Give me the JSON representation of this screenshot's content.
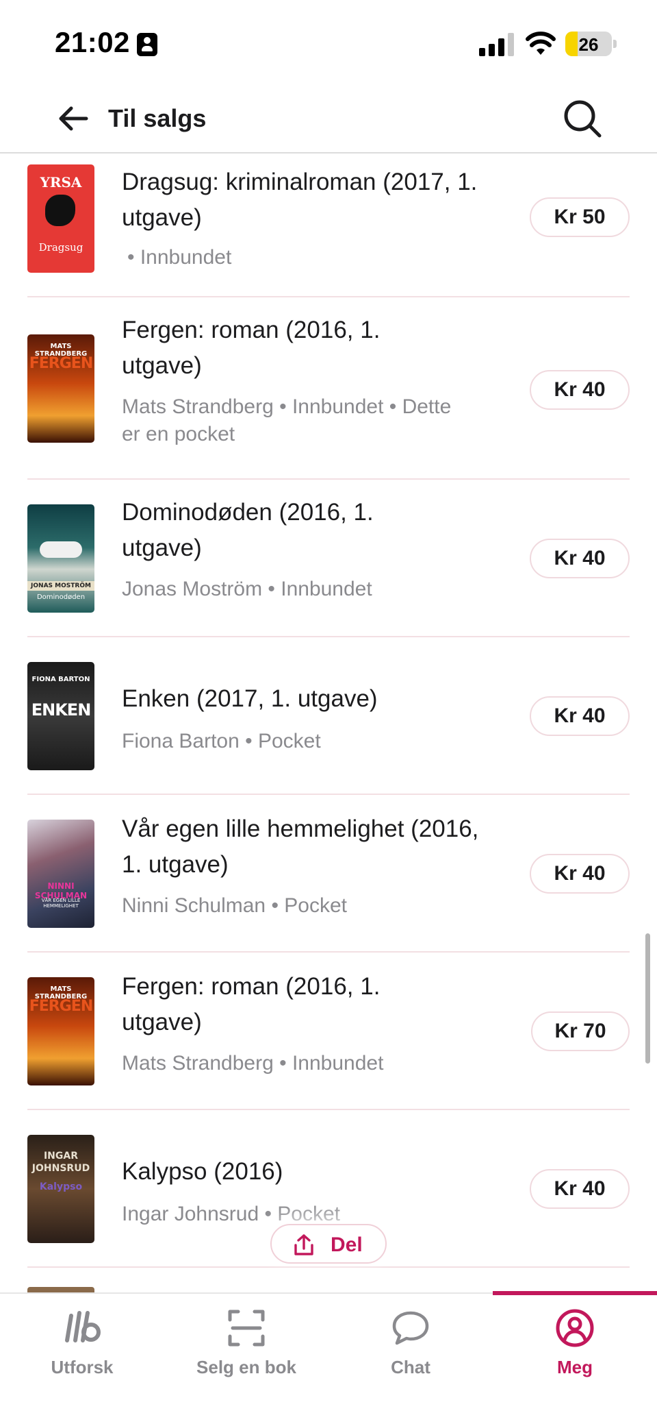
{
  "status_bar": {
    "time": "21:02",
    "battery": "26",
    "battery_color": "#f7d400"
  },
  "header": {
    "back_icon": "arrow-left-icon",
    "title": "Til salgs",
    "search_icon": "search-icon"
  },
  "books": [
    {
      "title": "Dragsug: kriminalroman (2017, 1. utgave)",
      "meta": "• Innbundet",
      "price": "Kr 50",
      "cover_text": "YRSA",
      "cover_subtext": "Dragsug",
      "cover_color": "#e53935"
    },
    {
      "title": "Fergen: roman (2016, 1. utgave)",
      "meta": "Mats Strandberg • Innbundet • Dette er en pocket",
      "price": "Kr 40",
      "cover_text": "FERGEN",
      "cover_subtext": "MATS STRANDBERG",
      "cover_color": "#c8470e"
    },
    {
      "title": "Dominodøden (2016, 1. utgave)",
      "meta": "Jonas Moström • Innbundet",
      "price": "Kr 40",
      "cover_text": "JONAS MOSTRÖM",
      "cover_subtext": "Dominodøden",
      "cover_color": "#1f5c5a"
    },
    {
      "title": "Enken (2017, 1. utgave)",
      "meta": "Fiona Barton • Pocket",
      "price": "Kr 40",
      "cover_text": "ENKEN",
      "cover_subtext": "FIONA BARTON",
      "cover_color": "#2b2b2b"
    },
    {
      "title": "Vår egen lille hemmelighet (2016, 1. utgave)",
      "meta": "Ninni Schulman • Pocket",
      "price": "Kr 40",
      "cover_text": "NINNI SCHULMAN",
      "cover_subtext": "VÅR EGEN LILLE HEMMELIGHET",
      "cover_color": "#5a5f79"
    },
    {
      "title": "Fergen: roman (2016, 1. utgave)",
      "meta": "Mats Strandberg • Innbundet",
      "price": "Kr 70",
      "cover_text": "FERGEN",
      "cover_subtext": "MATS STRANDBERG",
      "cover_color": "#c8470e"
    },
    {
      "title": "Kalypso (2016)",
      "meta": "Ingar Johnsrud • Pocket",
      "price": "Kr 40",
      "cover_text": "INGAR JOHNSRUD",
      "cover_subtext": "Kalypso",
      "cover_color": "#4a3a2c"
    }
  ],
  "share": {
    "label": "Del",
    "icon": "share-icon"
  },
  "tabs": [
    {
      "label": "Utforsk",
      "icon": "lb-logo-icon"
    },
    {
      "label": "Selg en bok",
      "icon": "scan-icon"
    },
    {
      "label": "Chat",
      "icon": "chat-bubble-icon"
    },
    {
      "label": "Meg",
      "icon": "profile-icon",
      "active": true
    }
  ],
  "accent_color": "#c2185b"
}
